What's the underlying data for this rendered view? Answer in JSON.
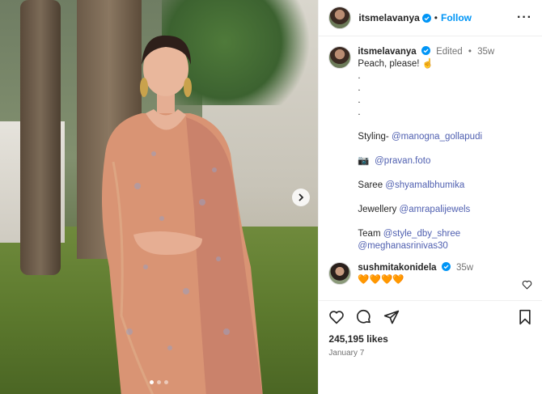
{
  "post": {
    "author": "itsmelavanya",
    "follow_label": "Follow",
    "edited_label": "Edited",
    "age": "35w",
    "caption_lines": [
      "Peach, please! ☝️",
      ".",
      ".",
      ".",
      ".",
      "",
      "Styling- @manogna_gollapudi",
      "",
      "📷  @pravan.foto",
      "",
      "Saree @shyamalbhumika",
      "",
      "Jewellery @amrapalijewels",
      "",
      "Team @style_dby_shree",
      "@meghanasrinivas30"
    ],
    "caption": {
      "line1": "Peach, please! ☝️",
      "styling_label": "Styling- ",
      "styling_mention": "@manogna_gollapudi",
      "camera_icon": "📷",
      "photo_mention": "@pravan.foto",
      "saree_label": "Saree ",
      "saree_mention": "@shyamalbhumika",
      "jewellery_label": "Jewellery ",
      "jewellery_mention": "@amrapalijewels",
      "team_label": "Team ",
      "team_mention1": "@style_dby_shree",
      "team_mention2": "@meghanasrinivas30"
    },
    "comment": {
      "author": "sushmitakonidela",
      "age": "35w",
      "text": "🧡🧡🧡🧡"
    },
    "likes": "245,195 likes",
    "date": "January 7",
    "carousel": {
      "total": 3,
      "active": 0
    }
  },
  "colors": {
    "accent": "#0095f6",
    "mention": "#4f5fb0",
    "muted": "#737373"
  },
  "icons": {
    "verified": "verified-badge-icon",
    "more": "more-options-icon",
    "like": "heart-icon",
    "comment": "comment-icon",
    "share": "share-icon",
    "save": "bookmark-icon",
    "next": "chevron-right-icon"
  }
}
